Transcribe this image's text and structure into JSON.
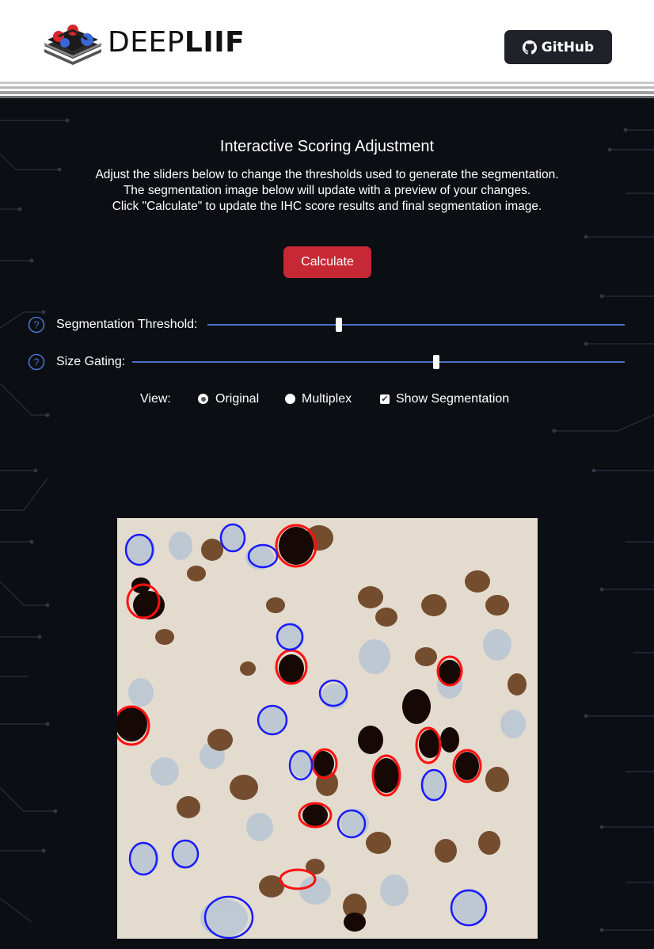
{
  "header": {
    "logo_text_light": "DEEP",
    "logo_text_bold": "LIIF",
    "github_label": "GitHub"
  },
  "panel": {
    "title": "Interactive Scoring Adjustment",
    "description": [
      "Adjust the sliders below to change the thresholds used to generate the segmentation.",
      "The segmentation image below will update with a preview of your changes.",
      "Click \"Calculate\" to update the IHC score results and final segmentation image."
    ],
    "calculate_label": "Calculate"
  },
  "sliders": [
    {
      "label": "Segmentation Threshold:",
      "value_fraction": 0.315
    },
    {
      "label": "Size Gating:",
      "value_fraction": 0.618
    }
  ],
  "view": {
    "label": "View:",
    "options": [
      {
        "label": "Original",
        "selected": true
      },
      {
        "label": "Multiplex",
        "selected": false
      }
    ],
    "show_segmentation_label": "Show Segmentation",
    "show_segmentation_checked": true
  },
  "colors": {
    "background": "#0b0e13",
    "accent_button": "#c62935",
    "slider_track": "#4a71c8",
    "positive_outline": "#ff1010",
    "negative_outline": "#1a1aff"
  },
  "icons": {
    "help": "question-circle-icon",
    "github": "github-icon",
    "logo": "deepliif-logo-icon"
  }
}
